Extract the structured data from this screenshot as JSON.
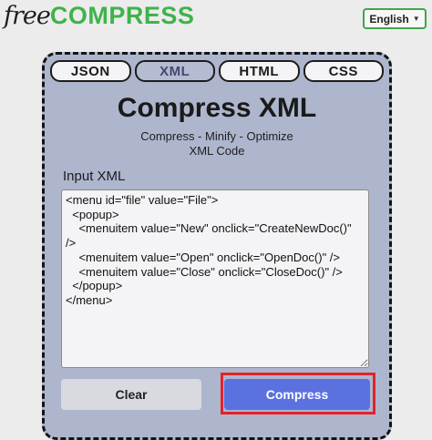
{
  "header": {
    "logo_free": "free",
    "logo_compress": "COMPRESS",
    "language": "English"
  },
  "tabs": [
    {
      "label": "JSON",
      "active": false
    },
    {
      "label": "XML",
      "active": true
    },
    {
      "label": "HTML",
      "active": false
    },
    {
      "label": "CSS",
      "active": false
    }
  ],
  "main": {
    "title": "Compress XML",
    "subtitle_line1": "Compress - Minify - Optimize",
    "subtitle_line2": "XML Code",
    "input_label": "Input XML",
    "input_value": "<menu id=\"file\" value=\"File\">\n  <popup>\n    <menuitem value=\"New\" onclick=\"CreateNewDoc()\" />\n    <menuitem value=\"Open\" onclick=\"OpenDoc()\" />\n    <menuitem value=\"Close\" onclick=\"CloseDoc()\" />\n  </popup>\n</menu>",
    "clear_label": "Clear",
    "compress_label": "Compress"
  },
  "colors": {
    "brand_green": "#3fb34a",
    "panel_bg": "#aeb6ce",
    "compress_button": "#5b71e0",
    "highlight_red": "#e2232a"
  }
}
